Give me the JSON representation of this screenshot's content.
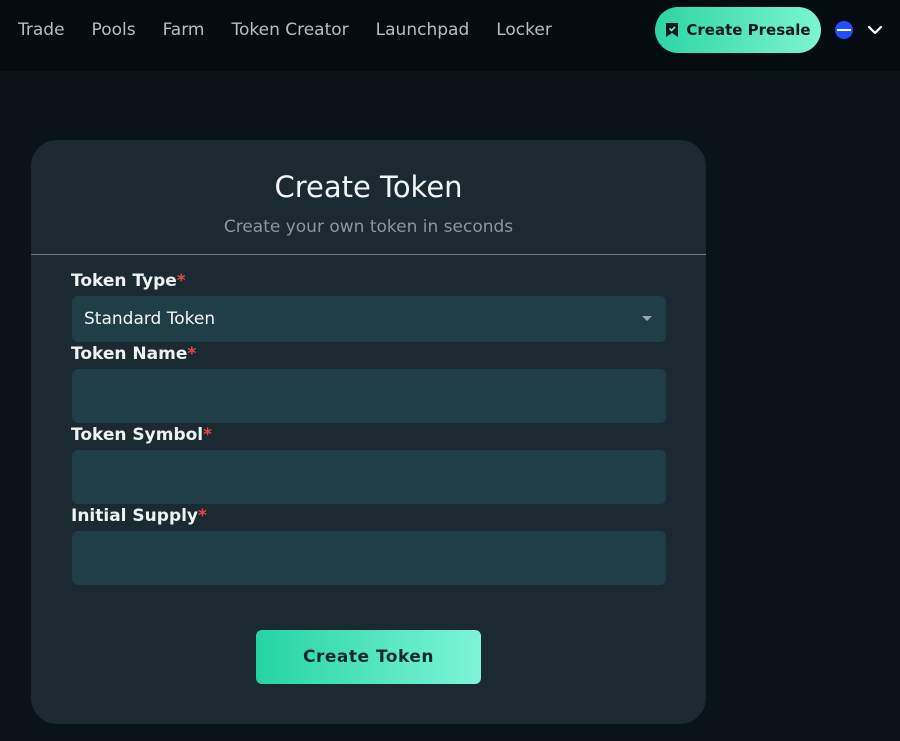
{
  "nav": {
    "items": [
      {
        "label": "Trade"
      },
      {
        "label": "Pools"
      },
      {
        "label": "Farm"
      },
      {
        "label": "Token Creator"
      },
      {
        "label": "Launchpad"
      },
      {
        "label": "Locker"
      }
    ],
    "presale_button": {
      "label": "Create Presale",
      "icon": "presale-tag-icon"
    },
    "chain_icon": "network-chain-icon",
    "chevron_icon": "chevron-down-icon"
  },
  "form": {
    "title": "Create Token",
    "subtitle": "Create your own token in seconds",
    "required_mark": "*",
    "token_type": {
      "label": "Token Type",
      "value": "Standard Token"
    },
    "token_name": {
      "label": "Token Name",
      "value": "",
      "placeholder": ""
    },
    "token_symbol": {
      "label": "Token Symbol",
      "value": "",
      "placeholder": ""
    },
    "initial_supply": {
      "label": "Initial Supply",
      "value": "",
      "placeholder": ""
    },
    "submit_label": "Create Token"
  },
  "colors": {
    "accent_start": "#25d4a2",
    "accent_end": "#7cf5d6",
    "required": "#e5484d",
    "card_bg": "#1b2a31",
    "field_bg": "#1f3e46"
  }
}
